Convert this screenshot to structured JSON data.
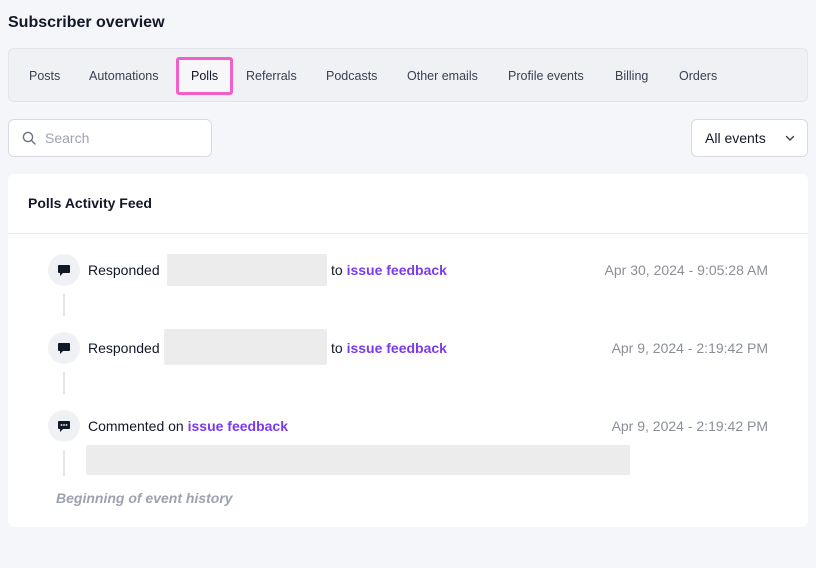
{
  "page": {
    "title": "Subscriber overview"
  },
  "tabs": [
    {
      "label": "Posts",
      "active": false
    },
    {
      "label": "Automations",
      "active": false
    },
    {
      "label": "Polls",
      "active": true
    },
    {
      "label": "Referrals",
      "active": false
    },
    {
      "label": "Podcasts",
      "active": false
    },
    {
      "label": "Other emails",
      "active": false
    },
    {
      "label": "Profile events",
      "active": false
    },
    {
      "label": "Billing",
      "active": false
    },
    {
      "label": "Orders",
      "active": false
    }
  ],
  "search": {
    "placeholder": "Search",
    "value": ""
  },
  "filter": {
    "selected": "All events"
  },
  "feed": {
    "title": "Polls Activity Feed",
    "events": [
      {
        "icon": "chat-bubble-icon",
        "action": "Responded",
        "connector": "to",
        "link": "issue feedback",
        "timestamp": "Apr 30, 2024 - 9:05:28 AM"
      },
      {
        "icon": "chat-bubble-icon",
        "action": "Responded",
        "connector": "to",
        "link": "issue feedback",
        "timestamp": "Apr 9, 2024 - 2:19:42 PM"
      },
      {
        "icon": "comment-bubble-icon",
        "action": "Commented on",
        "link": "issue feedback",
        "timestamp": "Apr 9, 2024 - 2:19:42 PM"
      }
    ],
    "end_text": "Beginning of event history"
  },
  "colors": {
    "accent": "#7c3aed",
    "active_tab_border": "#f060c8"
  }
}
